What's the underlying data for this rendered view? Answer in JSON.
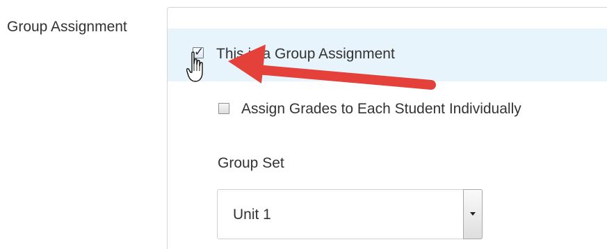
{
  "form": {
    "section_label": "Group Assignment",
    "group_assignment_checkbox": {
      "label": "This is a Group Assignment",
      "checked": true
    },
    "individual_grades_checkbox": {
      "label": "Assign Grades to Each Student Individually",
      "checked": false
    },
    "group_set": {
      "label": "Group Set",
      "selected": "Unit 1"
    }
  },
  "annotation": {
    "arrow_color": "#e5413b",
    "highlight_color": "#e8f4fb"
  },
  "icons": {
    "cursor": "hand-pointer-icon",
    "checkmark": "checkmark-icon",
    "dropdown": "chevron-down-icon"
  }
}
